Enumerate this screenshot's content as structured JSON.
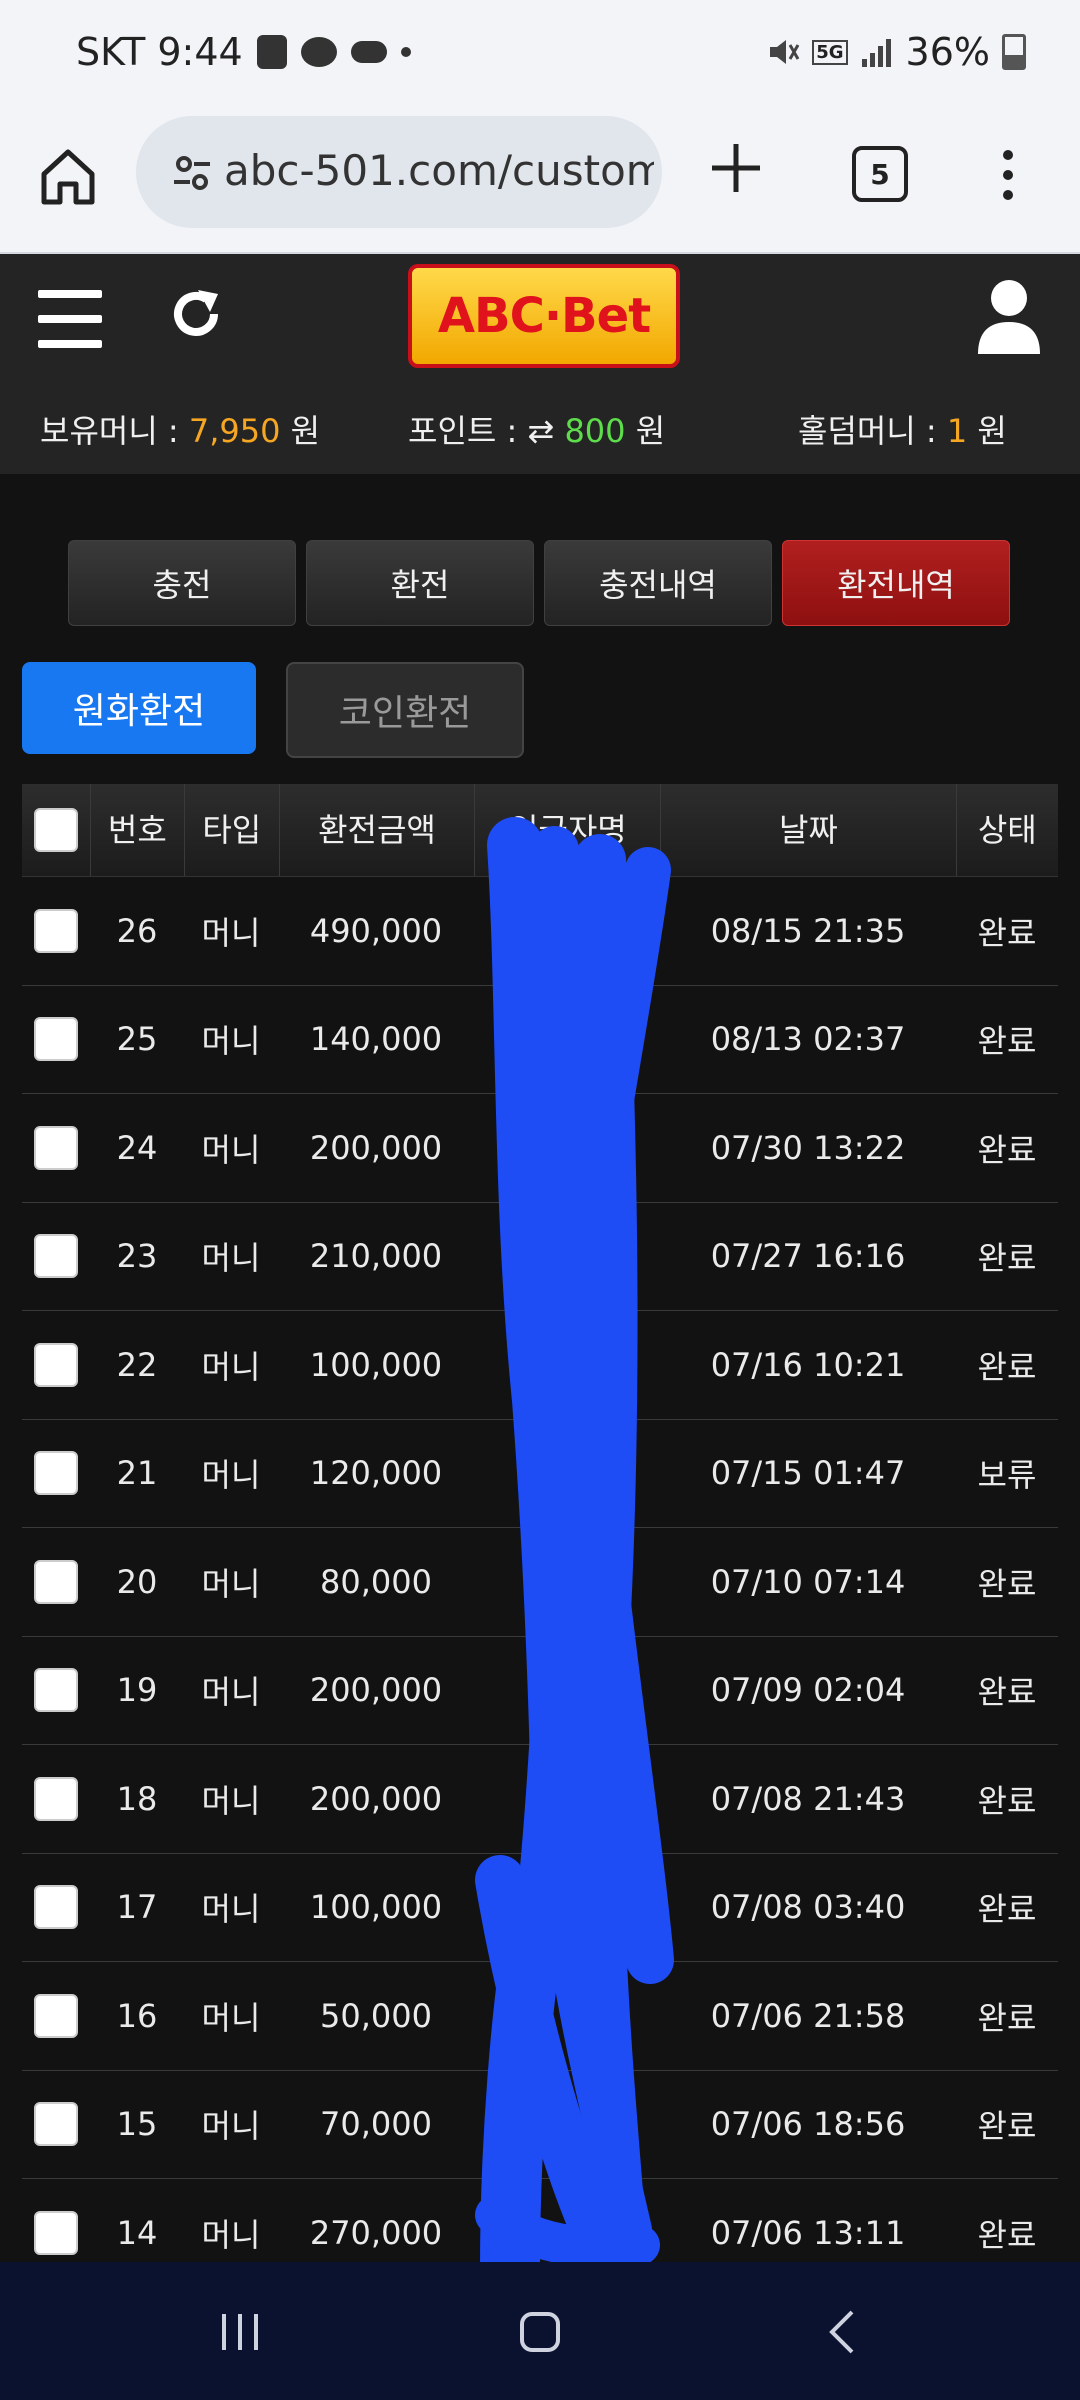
{
  "status_bar": {
    "carrier_time": "SKT 9:44",
    "battery": "36%",
    "network": "5G"
  },
  "browser": {
    "url": "abc-501.com/custom",
    "tab_count": "5"
  },
  "header": {
    "logo": "ABC·Bet",
    "balance_label": "보유머니 : ",
    "balance_value": "7,950",
    "balance_unit": " 원",
    "points_label": "포인트 : ",
    "points_value": "800",
    "points_unit": " 원",
    "holdem_label": "홀덤머니 : ",
    "holdem_value": "1",
    "holdem_unit": " 원"
  },
  "nav": {
    "buttons": [
      "충전",
      "환전",
      "충전내역",
      "환전내역"
    ],
    "active": "환전내역"
  },
  "subtabs": {
    "krw": "원화환전",
    "coin": "코인환전"
  },
  "table": {
    "headers": [
      "번호",
      "타입",
      "환전금액",
      "입금자명",
      "날짜",
      "상태"
    ],
    "rows": [
      {
        "no": "26",
        "type": "머니",
        "amount": "490,000",
        "name": "",
        "date": "08/15 21:35",
        "status": "완료"
      },
      {
        "no": "25",
        "type": "머니",
        "amount": "140,000",
        "name": "",
        "date": "08/13 02:37",
        "status": "완료"
      },
      {
        "no": "24",
        "type": "머니",
        "amount": "200,000",
        "name": "",
        "date": "07/30 13:22",
        "status": "완료"
      },
      {
        "no": "23",
        "type": "머니",
        "amount": "210,000",
        "name": "",
        "date": "07/27 16:16",
        "status": "완료"
      },
      {
        "no": "22",
        "type": "머니",
        "amount": "100,000",
        "name": "",
        "date": "07/16 10:21",
        "status": "완료"
      },
      {
        "no": "21",
        "type": "머니",
        "amount": "120,000",
        "name": "",
        "date": "07/15 01:47",
        "status": "보류"
      },
      {
        "no": "20",
        "type": "머니",
        "amount": "80,000",
        "name": "",
        "date": "07/10 07:14",
        "status": "완료"
      },
      {
        "no": "19",
        "type": "머니",
        "amount": "200,000",
        "name": "",
        "date": "07/09 02:04",
        "status": "완료"
      },
      {
        "no": "18",
        "type": "머니",
        "amount": "200,000",
        "name": "",
        "date": "07/08 21:43",
        "status": "완료"
      },
      {
        "no": "17",
        "type": "머니",
        "amount": "100,000",
        "name": "",
        "date": "07/08 03:40",
        "status": "완료"
      },
      {
        "no": "16",
        "type": "머니",
        "amount": "50,000",
        "name": "",
        "date": "07/06 21:58",
        "status": "완료"
      },
      {
        "no": "15",
        "type": "머니",
        "amount": "70,000",
        "name": "",
        "date": "07/06 18:56",
        "status": "완료"
      },
      {
        "no": "14",
        "type": "머니",
        "amount": "270,000",
        "name": "",
        "date": "07/06 13:11",
        "status": "완료"
      }
    ]
  },
  "colors": {
    "accent_blue": "#1878f2",
    "active_red": "#a51818",
    "balance_orange": "#f5a623",
    "points_green": "#5ddc4c",
    "redaction_blue": "#1e4cf5"
  }
}
